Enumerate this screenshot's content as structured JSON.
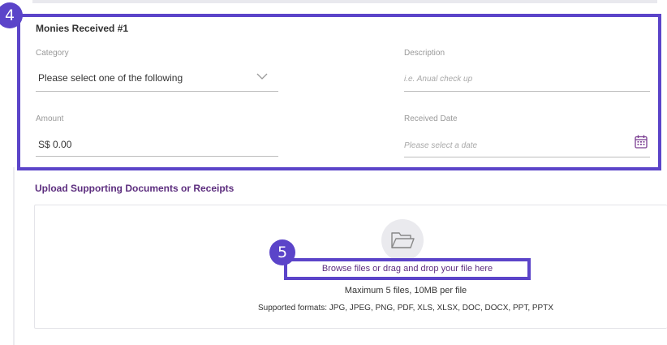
{
  "section": {
    "title": "Monies Received #1",
    "badge": "4"
  },
  "category": {
    "label": "Category",
    "value": "Please select one of the following"
  },
  "description": {
    "label": "Description",
    "placeholder": "i.e. Anual check up"
  },
  "amount": {
    "label": "Amount",
    "value": "S$ 0.00"
  },
  "received_date": {
    "label": "Received Date",
    "placeholder": "Please select a date"
  },
  "upload": {
    "title": "Upload Supporting Documents or Receipts",
    "badge": "5",
    "browse_text": "Browse files or drag and drop your file here",
    "limits": "Maximum 5 files, 10MB per file",
    "formats": "Supported formats: JPG, JPEG, PNG, PDF, XLS, XLSX, DOC, DOCX, PPT, PPTX"
  },
  "colors": {
    "highlight": "#5b44c9",
    "accent_text": "#5c2d7e",
    "calendar_icon": "#7a3d91"
  },
  "icons": {
    "dropdown": "chevron-down-icon",
    "date_picker": "calendar-icon",
    "upload": "folder-icon"
  }
}
